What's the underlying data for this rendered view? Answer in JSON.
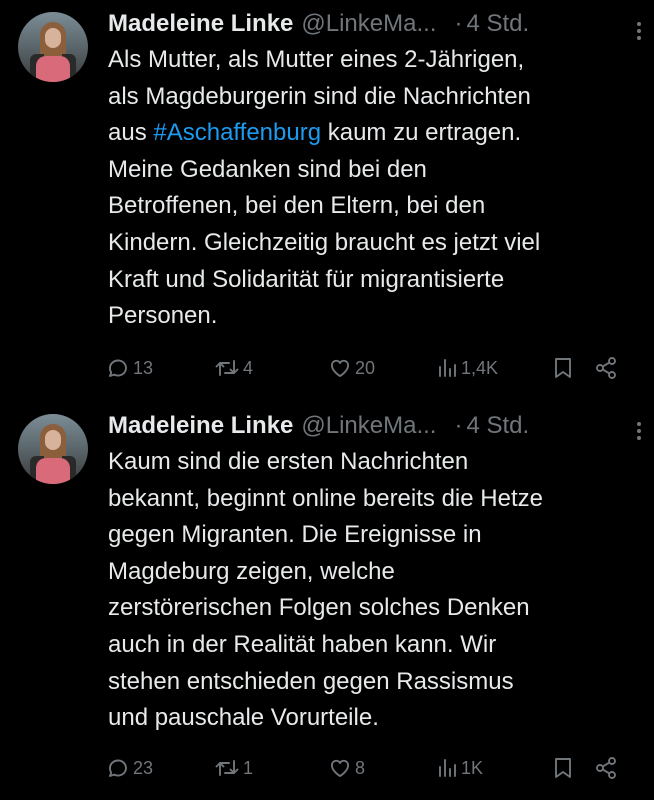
{
  "tweets": [
    {
      "author": {
        "name": "Madeleine Linke",
        "handle": "@LinkeMa..."
      },
      "dot": "·",
      "time": "4 Std.",
      "text_lines": [
        {
          "pre": "Als Mutter, als Mutter eines 2-Jährigen,",
          "tag": "",
          "post": ""
        },
        {
          "pre": "als Magdeburgerin sind die Nachrichten",
          "tag": "",
          "post": ""
        },
        {
          "pre": "aus ",
          "tag": "#Aschaffenburg",
          "post": " kaum zu ertragen."
        },
        {
          "pre": "Meine Gedanken sind bei den",
          "tag": "",
          "post": ""
        },
        {
          "pre": "Betroffenen, bei den Eltern, bei den",
          "tag": "",
          "post": ""
        },
        {
          "pre": "Kindern. Gleichzeitig braucht es jetzt viel",
          "tag": "",
          "post": ""
        },
        {
          "pre": "Kraft und Solidarität für migrantisierte",
          "tag": "",
          "post": ""
        },
        {
          "pre": "Personen.",
          "tag": "",
          "post": ""
        }
      ],
      "stats": {
        "replies": "13",
        "reposts": "4",
        "likes": "20",
        "views": "1,4K"
      }
    },
    {
      "author": {
        "name": "Madeleine Linke",
        "handle": "@LinkeMa..."
      },
      "dot": "·",
      "time": "4 Std.",
      "text_lines": [
        {
          "pre": "Kaum sind die ersten Nachrichten",
          "tag": "",
          "post": ""
        },
        {
          "pre": "bekannt, beginnt online bereits die Hetze",
          "tag": "",
          "post": ""
        },
        {
          "pre": "gegen Migranten. Die Ereignisse in",
          "tag": "",
          "post": ""
        },
        {
          "pre": "Magdeburg zeigen, welche",
          "tag": "",
          "post": ""
        },
        {
          "pre": "zerstörerischen Folgen solches Denken",
          "tag": "",
          "post": ""
        },
        {
          "pre": "auch in der Realität haben kann. Wir",
          "tag": "",
          "post": ""
        },
        {
          "pre": "stehen entschieden gegen Rassismus",
          "tag": "",
          "post": ""
        },
        {
          "pre": "und pauschale Vorurteile.",
          "tag": "",
          "post": ""
        }
      ],
      "stats": {
        "replies": "23",
        "reposts": "1",
        "likes": "8",
        "views": "1K"
      }
    }
  ],
  "icons": {
    "reply": "reply-icon",
    "repost": "repost-icon",
    "like": "like-icon",
    "views": "views-icon",
    "bookmark": "bookmark-icon",
    "share": "share-icon",
    "more": "more-icon"
  },
  "colors": {
    "background": "#000000",
    "text": "#e7e9ea",
    "muted": "#71767b",
    "hashtag": "#1d9bf0"
  }
}
